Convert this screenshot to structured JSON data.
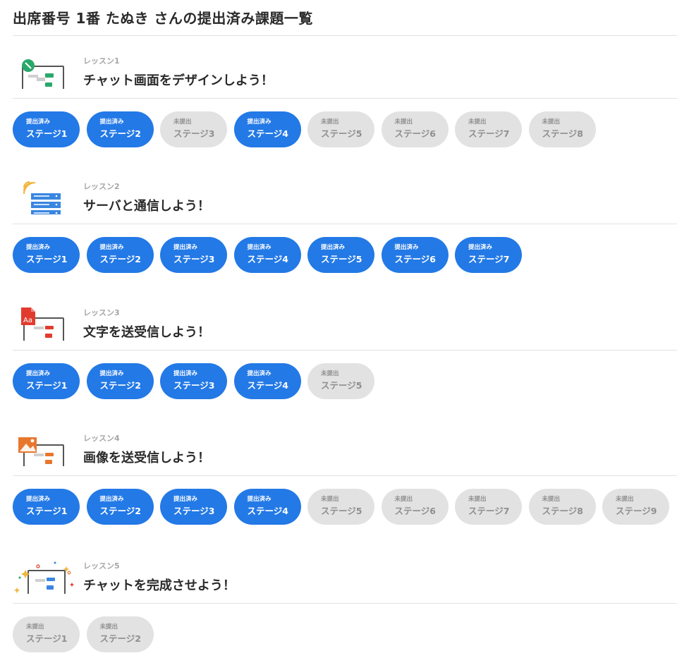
{
  "page": {
    "title": "出席番号 1番 たぬき さんの提出済み課題一覧"
  },
  "lessons": [
    {
      "label": "レッスン1",
      "name": "チャット画面をデザインしよう！",
      "stages": [
        {
          "status": "提出済み",
          "name": "ステージ1",
          "submitted": true
        },
        {
          "status": "提出済み",
          "name": "ステージ2",
          "submitted": true
        },
        {
          "status": "未提出",
          "name": "ステージ3",
          "submitted": false
        },
        {
          "status": "提出済み",
          "name": "ステージ4",
          "submitted": true
        },
        {
          "status": "未提出",
          "name": "ステージ5",
          "submitted": false
        },
        {
          "status": "未提出",
          "name": "ステージ6",
          "submitted": false
        },
        {
          "status": "未提出",
          "name": "ステージ7",
          "submitted": false
        },
        {
          "status": "未提出",
          "name": "ステージ8",
          "submitted": false
        }
      ]
    },
    {
      "label": "レッスン2",
      "name": "サーバと通信しよう！",
      "stages": [
        {
          "status": "提出済み",
          "name": "ステージ1",
          "submitted": true
        },
        {
          "status": "提出済み",
          "name": "ステージ2",
          "submitted": true
        },
        {
          "status": "提出済み",
          "name": "ステージ3",
          "submitted": true
        },
        {
          "status": "提出済み",
          "name": "ステージ4",
          "submitted": true
        },
        {
          "status": "提出済み",
          "name": "ステージ5",
          "submitted": true
        },
        {
          "status": "提出済み",
          "name": "ステージ6",
          "submitted": true
        },
        {
          "status": "提出済み",
          "name": "ステージ7",
          "submitted": true
        }
      ]
    },
    {
      "label": "レッスン3",
      "name": "文字を送受信しよう！",
      "stages": [
        {
          "status": "提出済み",
          "name": "ステージ1",
          "submitted": true
        },
        {
          "status": "提出済み",
          "name": "ステージ2",
          "submitted": true
        },
        {
          "status": "提出済み",
          "name": "ステージ3",
          "submitted": true
        },
        {
          "status": "提出済み",
          "name": "ステージ4",
          "submitted": true
        },
        {
          "status": "未提出",
          "name": "ステージ5",
          "submitted": false
        }
      ]
    },
    {
      "label": "レッスン4",
      "name": "画像を送受信しよう！",
      "stages": [
        {
          "status": "提出済み",
          "name": "ステージ1",
          "submitted": true
        },
        {
          "status": "提出済み",
          "name": "ステージ2",
          "submitted": true
        },
        {
          "status": "提出済み",
          "name": "ステージ3",
          "submitted": true
        },
        {
          "status": "提出済み",
          "name": "ステージ4",
          "submitted": true
        },
        {
          "status": "未提出",
          "name": "ステージ5",
          "submitted": false
        },
        {
          "status": "未提出",
          "name": "ステージ6",
          "submitted": false
        },
        {
          "status": "未提出",
          "name": "ステージ7",
          "submitted": false
        },
        {
          "status": "未提出",
          "name": "ステージ8",
          "submitted": false
        },
        {
          "status": "未提出",
          "name": "ステージ9",
          "submitted": false
        }
      ]
    },
    {
      "label": "レッスン5",
      "name": "チャットを完成させよう！",
      "stages": [
        {
          "status": "未提出",
          "name": "ステージ1",
          "submitted": false
        },
        {
          "status": "未提出",
          "name": "ステージ2",
          "submitted": false
        }
      ]
    }
  ],
  "icons": [
    "chat-design-laptop-icon",
    "server-signal-icon",
    "text-document-laptop-icon",
    "image-laptop-icon",
    "chat-complete-sparkle-icon"
  ],
  "colors": {
    "submitted": "#2379e6",
    "not_submitted": "#e2e2e2",
    "text": "#2a2a2a",
    "muted": "#a6a6a6"
  }
}
